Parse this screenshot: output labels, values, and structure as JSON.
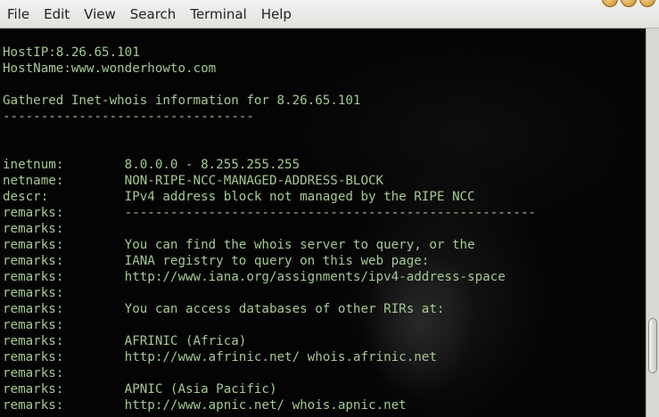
{
  "menu": [
    "File",
    "Edit",
    "View",
    "Search",
    "Terminal",
    "Help"
  ],
  "terminal": {
    "lines": [
      "",
      "HostIP:8.26.65.101",
      "HostName:www.wonderhowto.com",
      "",
      "Gathered Inet-whois information for 8.26.65.101",
      "---------------------------------",
      "",
      "",
      "inetnum:        8.0.0.0 - 8.255.255.255",
      "netname:        NON-RIPE-NCC-MANAGED-ADDRESS-BLOCK",
      "descr:          IPv4 address block not managed by the RIPE NCC",
      "remarks:        ------------------------------------------------------",
      "remarks:",
      "remarks:        You can find the whois server to query, or the",
      "remarks:        IANA registry to query on this web page:",
      "remarks:        http://www.iana.org/assignments/ipv4-address-space",
      "remarks:",
      "remarks:        You can access databases of other RIRs at:",
      "remarks:",
      "remarks:        AFRINIC (Africa)",
      "remarks:        http://www.afrinic.net/ whois.afrinic.net",
      "remarks:",
      "remarks:        APNIC (Asia Pacific)",
      "remarks:        http://www.apnic.net/ whois.apnic.net"
    ]
  },
  "colors": {
    "terminal_text": "#a4c992",
    "terminal_bg": "#040404",
    "menubar_bg": "#e9e7e4"
  },
  "scrollbar": {
    "position_fraction": 0.92
  }
}
